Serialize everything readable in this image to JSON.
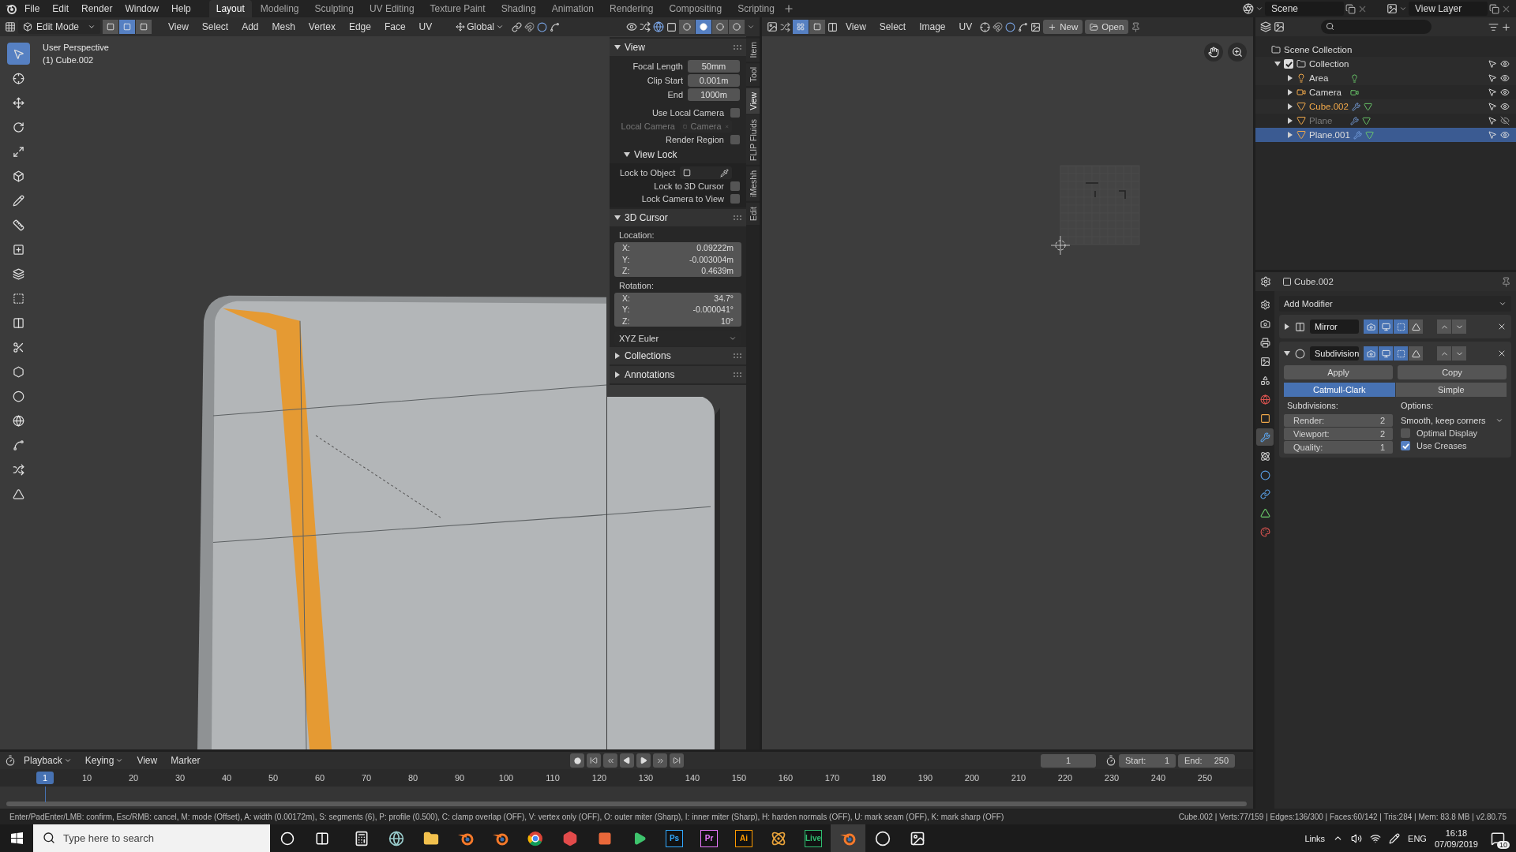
{
  "topbar": {
    "menus": [
      "File",
      "Edit",
      "Render",
      "Window",
      "Help"
    ],
    "workspaces": [
      {
        "label": "Layout",
        "selected": true
      },
      {
        "label": "Modeling",
        "selected": false
      },
      {
        "label": "Sculpting",
        "selected": false
      },
      {
        "label": "UV Editing",
        "selected": false
      },
      {
        "label": "Texture Paint",
        "selected": false
      },
      {
        "label": "Shading",
        "selected": false
      },
      {
        "label": "Animation",
        "selected": false
      },
      {
        "label": "Rendering",
        "selected": false
      },
      {
        "label": "Compositing",
        "selected": false
      },
      {
        "label": "Scripting",
        "selected": false
      }
    ],
    "scene": "Scene",
    "view_layer": "View Layer"
  },
  "viewport": {
    "mode": "Edit Mode",
    "select_modes": [
      {
        "selected": false
      },
      {
        "selected": true
      },
      {
        "selected": false
      }
    ],
    "menus": [
      "View",
      "Select",
      "Add",
      "Mesh",
      "Vertex",
      "Edge",
      "Face",
      "UV"
    ],
    "orientation": "Global",
    "shading_modes": [
      {
        "selected": false
      },
      {
        "selected": true
      },
      {
        "selected": false
      },
      {
        "selected": false
      }
    ],
    "view_name": "User Perspective",
    "object_label": "(1) Cube.002",
    "tools": [
      {
        "selected": true
      },
      {
        "selected": false
      },
      {
        "selected": false
      },
      {
        "selected": false
      },
      {
        "selected": false
      },
      {
        "selected": false
      },
      {
        "selected": false
      },
      {
        "selected": false
      },
      {
        "selected": false
      },
      {
        "selected": false
      },
      {
        "selected": false
      },
      {
        "selected": false
      },
      {
        "selected": false
      },
      {
        "selected": false
      },
      {
        "selected": false
      },
      {
        "selected": false
      },
      {
        "selected": false
      },
      {
        "selected": false
      },
      {
        "selected": false
      }
    ],
    "sidebar": {
      "view_panel": {
        "title": "View",
        "expanded": true,
        "fields": [
          {
            "label": "Focal Length",
            "value": "50mm"
          },
          {
            "label": "Clip Start",
            "value": "0.001m"
          },
          {
            "label": "End",
            "value": "1000m"
          }
        ],
        "rows": [
          {
            "kind": "check",
            "label": "Use Local Camera",
            "checked": false
          },
          {
            "kind": "object",
            "label": "Local Camera",
            "value": "Camera",
            "disabled": true
          },
          {
            "kind": "check",
            "label": "Render Region",
            "checked": false
          }
        ],
        "view_lock": {
          "title": "View Lock",
          "expanded": true,
          "object_label": "Lock to Object",
          "checks": [
            {
              "label": "Lock to 3D Cursor",
              "checked": false
            },
            {
              "label": "Lock Camera to View",
              "checked": false
            }
          ]
        }
      },
      "cursor_panel": {
        "title": "3D Cursor",
        "expanded": true,
        "location_label": "Location:",
        "location": [
          {
            "axis": "X:",
            "value": "0.09222m"
          },
          {
            "axis": "Y:",
            "value": "-0.003004m"
          },
          {
            "axis": "Z:",
            "value": "0.4639m"
          }
        ],
        "rotation_label": "Rotation:",
        "rotation": [
          {
            "axis": "X:",
            "value": "34.7°"
          },
          {
            "axis": "Y:",
            "value": "-0.000041°"
          },
          {
            "axis": "Z:",
            "value": "10°"
          }
        ],
        "rotation_mode": "XYZ Euler"
      },
      "collapsed_panels": [
        {
          "title": "Collections",
          "expanded": false
        },
        {
          "title": "Annotations",
          "expanded": false
        }
      ]
    },
    "sidebar_tabs": [
      {
        "label": "Item",
        "selected": false
      },
      {
        "label": "Tool",
        "selected": false
      },
      {
        "label": "View",
        "selected": true
      },
      {
        "label": "FLIP Fluids",
        "selected": false
      },
      {
        "label": "iMeshh",
        "selected": false
      },
      {
        "label": "Edit",
        "selected": false
      }
    ]
  },
  "image_editor": {
    "menus": [
      "View",
      "Select",
      "Image",
      "UV"
    ],
    "new_label": "New",
    "open_label": "Open"
  },
  "outliner": {
    "root": "Scene Collection",
    "collection": {
      "name": "Collection",
      "checked": true,
      "expanded": true,
      "children": [
        {
          "name": "Area",
          "kind": "light",
          "selected": false,
          "active": false,
          "hidden": false
        },
        {
          "name": "Camera",
          "kind": "camera",
          "selected": false,
          "active": false,
          "hidden": false
        },
        {
          "name": "Cube.002",
          "kind": "mesh",
          "selected": false,
          "active": true,
          "hidden": false
        },
        {
          "name": "Plane",
          "kind": "mesh",
          "selected": false,
          "active": false,
          "hidden": true
        },
        {
          "name": "Plane.001",
          "kind": "mesh",
          "selected": true,
          "active": false,
          "hidden": false
        }
      ]
    }
  },
  "properties": {
    "object_name": "Cube.002",
    "add_modifier": "Add Modifier",
    "tabs": [
      {
        "selected": false
      },
      {
        "selected": false
      },
      {
        "selected": false
      },
      {
        "selected": false
      },
      {
        "selected": false
      },
      {
        "selected": false
      },
      {
        "selected": false
      },
      {
        "selected": true
      },
      {
        "selected": false
      },
      {
        "selected": false
      },
      {
        "selected": false
      },
      {
        "selected": false
      },
      {
        "selected": false
      }
    ],
    "modifiers": [
      {
        "name": "Mirror",
        "kind": "mirror",
        "expanded": false,
        "toggles": [
          {
            "on": true
          },
          {
            "on": true
          },
          {
            "on": true
          },
          {
            "on": false
          }
        ]
      },
      {
        "name": "Subdivision",
        "kind": "subdivision",
        "expanded": true,
        "toggles": [
          {
            "on": true
          },
          {
            "on": true
          },
          {
            "on": true
          },
          {
            "on": false
          }
        ]
      }
    ],
    "subdivision": {
      "apply": "Apply",
      "copy": "Copy",
      "algorithms": [
        {
          "label": "Catmull-Clark",
          "selected": true
        },
        {
          "label": "Simple",
          "selected": false
        }
      ],
      "levels_label": "Subdivisions:",
      "levels": [
        {
          "label": "Render:",
          "value": "2"
        },
        {
          "label": "Viewport:",
          "value": "2"
        },
        {
          "label": "Quality:",
          "value": "1"
        }
      ],
      "options_label": "Options:",
      "uv_smooth": "Smooth, keep corners",
      "checks": [
        {
          "label": "Optimal Display",
          "checked": false
        },
        {
          "label": "Use Creases",
          "checked": true
        }
      ]
    }
  },
  "timeline": {
    "menus": [
      {
        "label": "Playback",
        "dropdown": true
      },
      {
        "label": "Keying",
        "dropdown": true
      },
      {
        "label": "View",
        "dropdown": false
      },
      {
        "label": "Marker",
        "dropdown": false
      }
    ],
    "current_frame": "1",
    "start_label": "Start:",
    "start": "1",
    "end_label": "End:",
    "end": "250",
    "ruler_current": "1",
    "ruler_ticks": [
      "10",
      "20",
      "30",
      "40",
      "50",
      "60",
      "70",
      "80",
      "90",
      "100",
      "110",
      "120",
      "130",
      "140",
      "150",
      "160",
      "170",
      "180",
      "190",
      "200",
      "210",
      "220",
      "230",
      "240",
      "250"
    ]
  },
  "status_bar": {
    "hint": "Enter/PadEnter/LMB: confirm, Esc/RMB: cancel, M: mode (Offset), A: width (0.00172m), S: segments (6), P: profile (0.500), C: clamp overlap (OFF), V: vertex only (OFF), O: outer miter (Sharp), I: inner miter (Sharp), H: harden normals (OFF), U: mark seam (OFF), K: mark sharp (OFF)",
    "stats": "Cube.002 | Verts:77/159 | Edges:136/300 | Faces:60/142 | Tris:284 | Mem: 83.8 MB | v2.80.75"
  },
  "taskbar": {
    "search_placeholder": "Type here to search",
    "apps": [
      {
        "kind": "calculator",
        "active": false
      },
      {
        "kind": "network",
        "active": false
      },
      {
        "kind": "folder",
        "active": false
      },
      {
        "kind": "blender",
        "active": false
      },
      {
        "kind": "blender",
        "active": false
      },
      {
        "kind": "chrome",
        "active": false
      },
      {
        "kind": "badge-red",
        "active": false
      },
      {
        "kind": "badge-orange",
        "active": false
      },
      {
        "kind": "play",
        "active": false
      },
      {
        "kind": "label",
        "label": "Ps",
        "color": "#31a8ff",
        "active": false
      },
      {
        "kind": "label",
        "label": "Pr",
        "color": "#ea77ff",
        "active": false
      },
      {
        "kind": "label",
        "label": "Ai",
        "color": "#ff9a00",
        "active": false
      },
      {
        "kind": "flower",
        "active": false
      },
      {
        "kind": "label",
        "label": "Live",
        "color": "#2fbf71",
        "active": false
      },
      {
        "kind": "blender",
        "active": true
      },
      {
        "kind": "obs",
        "active": false
      },
      {
        "kind": "photos",
        "active": false
      }
    ],
    "tray": {
      "links": "Links",
      "language": "ENG",
      "time": "16:18",
      "date": "07/09/2019",
      "notifications": "10"
    }
  }
}
